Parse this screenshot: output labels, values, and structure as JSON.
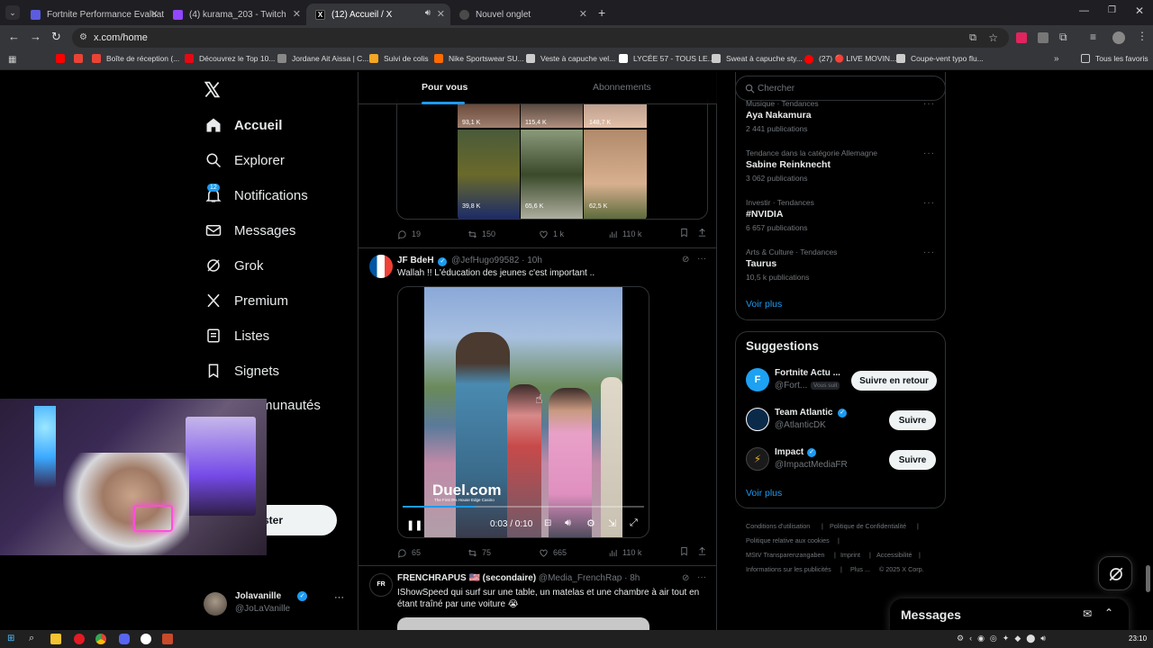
{
  "browser": {
    "tabs": [
      {
        "title": "Fortnite Performance Evaluatio",
        "favicon_color": "#5c5ce0"
      },
      {
        "title": "(4) kurama_203 - Twitch",
        "favicon_color": "#9146ff"
      },
      {
        "title": "(12) Accueil / X",
        "favicon_color": "#000000"
      },
      {
        "title": "Nouvel onglet",
        "favicon_color": "#4a4a4a"
      }
    ],
    "url": "x.com/home",
    "bookmarks": [
      {
        "label": "",
        "color": "#ff0000"
      },
      {
        "label": "",
        "color": "#ea4335"
      },
      {
        "label": "Boîte de réception (...",
        "color": "#ea4335"
      },
      {
        "label": "Découvrez le Top 10...",
        "color": "#e50914"
      },
      {
        "label": "Jordane Ait Aissa | C...",
        "color": "#888888"
      },
      {
        "label": "Suivi de colis",
        "color": "#f5a623"
      },
      {
        "label": "Nike Sportswear SU...",
        "color": "#ff6b00"
      },
      {
        "label": "Veste à capuche vel...",
        "color": "#cccccc"
      },
      {
        "label": "LYCÉE 57 - TOUS LE...",
        "color": "#ffffff"
      },
      {
        "label": "Sweat à capuche sty...",
        "color": "#cccccc"
      },
      {
        "label": "(27) 🔴 LIVE MOVIN...",
        "color": "#ff0000"
      },
      {
        "label": "Coupe-vent typo flu...",
        "color": "#cccccc"
      }
    ],
    "all_bookmarks": "Tous les favoris"
  },
  "sidebar": {
    "items": [
      {
        "label": "Accueil",
        "icon": "home-icon"
      },
      {
        "label": "Explorer",
        "icon": "search-icon"
      },
      {
        "label": "Notifications",
        "icon": "bell-icon",
        "badge": "12"
      },
      {
        "label": "Messages",
        "icon": "envelope-icon"
      },
      {
        "label": "Grok",
        "icon": "grok-icon"
      },
      {
        "label": "Premium",
        "icon": "x-icon"
      },
      {
        "label": "Listes",
        "icon": "list-icon"
      },
      {
        "label": "Signets",
        "icon": "bookmark-icon"
      },
      {
        "label": "munautés",
        "icon": "communities-icon"
      }
    ],
    "post_button": "ster",
    "account": {
      "name": "Jolavanille",
      "handle": "@JoLaVanille"
    }
  },
  "feed": {
    "tabs": [
      "Pour vous",
      "Abonnements"
    ],
    "tweet1": {
      "grid_counts": [
        "93,1 K",
        "115,4 K",
        "148,7 K",
        "39,8 K",
        "65,6 K",
        "62,5 K"
      ],
      "replies": "19",
      "reposts": "150",
      "likes": "1 k",
      "views": "110 k"
    },
    "tweet2": {
      "name": "JF BdeH",
      "handle": "@JefHugo99582",
      "time": "· 10h",
      "text": "Wallah !! L'éducation des jeunes c'est important ..",
      "video_watermark": "Duel.com",
      "video_sub": "The First 0% House Edge Casino",
      "video_time": "0:03 / 0:10",
      "video_progress": 0.3,
      "replies": "65",
      "reposts": "75",
      "likes": "665",
      "views": "110 k"
    },
    "tweet3": {
      "name": "FRENCHRAPUS 🇺🇸 (secondaire)",
      "handle": "@Media_FrenchRap",
      "time": "· 8h",
      "text": "IShowSpeed qui surf sur une table, un matelas et une chambre à air tout en étant traîné par une voiture 😭"
    }
  },
  "right": {
    "search_placeholder": "Chercher",
    "trends": [
      {
        "meta": "Musique · Tendances",
        "name": "Aya Nakamura",
        "count": "2 441 publications"
      },
      {
        "meta": "Tendance dans la catégorie Allemagne",
        "name": "Sabine Reinknecht",
        "count": "3 062 publications"
      },
      {
        "meta": "Investir · Tendances",
        "name": "#NVIDIA",
        "count": "6 657 publications"
      },
      {
        "meta": "Arts & Culture · Tendances",
        "name": "Taurus",
        "count": "10,5 k publications"
      }
    ],
    "show_more": "Voir plus",
    "suggestions_title": "Suggestions",
    "suggestions": [
      {
        "name": "Fortnite Actu ...",
        "handle": "@Fort...",
        "follows_you": "Vous suit",
        "button": "Suivre en retour",
        "avatar_color": "#1da1f2"
      },
      {
        "name": "Team Atlantic",
        "handle": "@AtlanticDK",
        "button": "Suivre",
        "avatar_color": "#0b2a4a"
      },
      {
        "name": "Impact",
        "handle": "@ImpactMediaFR",
        "button": "Suivre",
        "avatar_color": "#1a1a1a"
      }
    ],
    "footer": [
      "Conditions d'utilisation",
      "|",
      "Politique de Confidentialité",
      "|",
      "Politique relative aux cookies",
      "|",
      "MStV Transparenzangaben",
      "|",
      "Imprint",
      "|",
      "Accessibilité",
      "|",
      "Informations sur les publicités",
      "|",
      "Plus ...",
      "© 2025 X Corp."
    ],
    "messages_drawer": "Messages"
  },
  "taskbar": {
    "time": "23:10"
  }
}
